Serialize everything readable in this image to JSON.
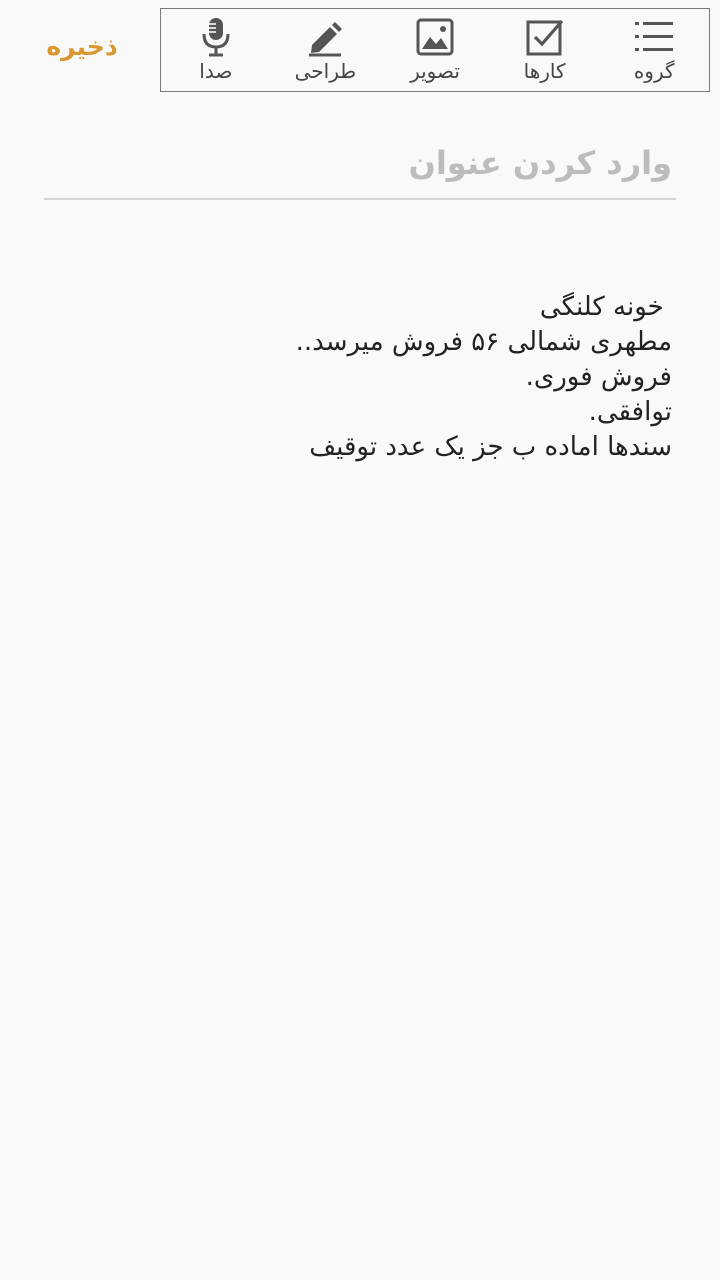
{
  "header": {
    "save_label": "ذخیره"
  },
  "toolbar": {
    "items": [
      {
        "label": "صدا",
        "icon": "microphone-icon"
      },
      {
        "label": "طراحی",
        "icon": "pencil-icon"
      },
      {
        "label": "تصویر",
        "icon": "image-icon"
      },
      {
        "label": "کارها",
        "icon": "checkbox-icon"
      },
      {
        "label": "گروه",
        "icon": "list-icon"
      }
    ]
  },
  "editor": {
    "title_placeholder": "وارد کردن عنوان",
    "title_value": "",
    "body_lines": [
      " خونه کلنگی",
      "مطهری شمالی ۵۶ فروش میرسد..",
      "فروش فوری.",
      "توافقی.",
      "سندها اماده ب جز یک عدد توقیف"
    ]
  },
  "colors": {
    "accent": "#d9982f",
    "background": "#f9f9f9",
    "icon": "#555555",
    "divider": "#d6d6d6"
  }
}
